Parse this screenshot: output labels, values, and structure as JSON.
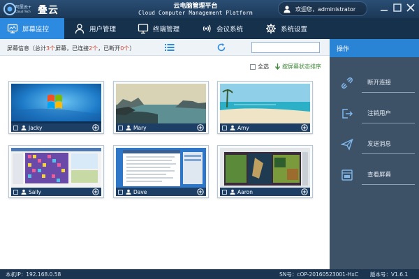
{
  "app": {
    "logo_small": "阿里云+",
    "logo_small2": "Cloud Tech",
    "logo_big": "叠云",
    "title_cn": "云电脑管理平台",
    "title_en": "Cloud Computer Management Platform",
    "user_text": "欢迎您，administrator"
  },
  "menu": {
    "items": [
      {
        "label": "屏幕监控",
        "icon": "monitor-screen-icon",
        "active": true
      },
      {
        "label": "用户管理",
        "icon": "user-icon"
      },
      {
        "label": "终端管理",
        "icon": "terminal-monitor-icon"
      },
      {
        "label": "会议系统",
        "icon": "broadcast-icon"
      },
      {
        "label": "系统设置",
        "icon": "gear-icon"
      }
    ]
  },
  "toolbar": {
    "info_prefix": "屏幕信息（总计",
    "total": "3个",
    "mid1": "屏幕，已连接",
    "connected": "2个",
    "mid2": "，已断开",
    "disconnected": "0个",
    "suffix": "）",
    "search_value": ""
  },
  "sortbar": {
    "select_all": "全选",
    "sort_label": "按屏幕状态排序"
  },
  "screens": [
    {
      "name": "Jacky",
      "kind": "win7"
    },
    {
      "name": "Mary",
      "kind": "coast"
    },
    {
      "name": "Amy",
      "kind": "beach"
    },
    {
      "name": "Sally",
      "kind": "game"
    },
    {
      "name": "Dave",
      "kind": "document"
    },
    {
      "name": "Aaron",
      "kind": "dark-game"
    }
  ],
  "panel": {
    "header": "操作",
    "actions": [
      {
        "label": "断开连接",
        "icon": "disconnect-icon"
      },
      {
        "label": "注销用户",
        "icon": "logout-icon"
      },
      {
        "label": "发送消息",
        "icon": "send-message-icon"
      },
      {
        "label": "查看屏幕",
        "icon": "view-screen-icon"
      }
    ]
  },
  "status": {
    "ip": "本机IP：192.168.0.58",
    "sn": "SN号：cOP-20160523001-HxC",
    "version": "版本号：V1.6.1"
  },
  "colors": {
    "accent": "#2c8be0",
    "title_bar": "#1c3857",
    "panel": "#3d5167",
    "count_red": "#d23f2a",
    "sort_green": "#3a8a33"
  }
}
